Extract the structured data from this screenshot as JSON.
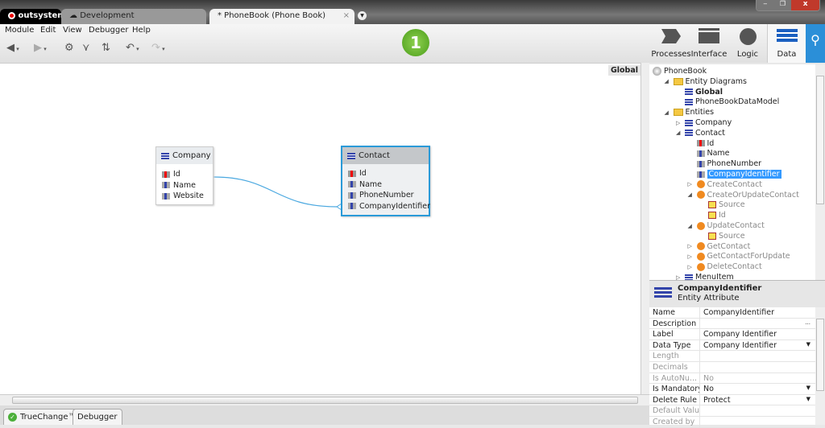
{
  "titlebar": {
    "logo": "outsystems",
    "tabs": [
      {
        "label": "Development"
      },
      {
        "label": "* PhoneBook (Phone Book)"
      }
    ],
    "close_tab": "×",
    "window_controls": [
      "minimize",
      "restore",
      "close"
    ]
  },
  "menu": [
    "Module",
    "Edit",
    "View",
    "Debugger",
    "Help"
  ],
  "step_badge": "1",
  "layers": [
    {
      "label": "Processes",
      "icon": "process-icon"
    },
    {
      "label": "Interface",
      "icon": "interface-icon"
    },
    {
      "label": "Logic",
      "icon": "logic-icon"
    },
    {
      "label": "Data",
      "icon": "data-icon",
      "active": true
    }
  ],
  "canvas": {
    "diagram_label": "Global",
    "entities": [
      {
        "name": "Company",
        "attributes": [
          "Id",
          "Name",
          "Website"
        ]
      },
      {
        "name": "Contact",
        "attributes": [
          "Id",
          "Name",
          "PhoneNumber",
          "CompanyIdentifier"
        ],
        "selected": true
      }
    ]
  },
  "tree": [
    {
      "label": "PhoneBook",
      "level": 0,
      "icon": "globe"
    },
    {
      "label": "Entity Diagrams",
      "level": 1,
      "icon": "folder",
      "open": true
    },
    {
      "label": "Global",
      "level": 2,
      "icon": "diagram",
      "bold": true
    },
    {
      "label": "PhoneBookDataModel",
      "level": 2,
      "icon": "diagram"
    },
    {
      "label": "Entities",
      "level": 1,
      "icon": "folder",
      "open": true
    },
    {
      "label": "Company",
      "level": 2,
      "icon": "entity",
      "closed": true
    },
    {
      "label": "Contact",
      "level": 2,
      "icon": "entity",
      "open": true
    },
    {
      "label": "Id",
      "level": 3,
      "icon": "key"
    },
    {
      "label": "Name",
      "level": 3,
      "icon": "attr"
    },
    {
      "label": "PhoneNumber",
      "level": 3,
      "icon": "attr"
    },
    {
      "label": "CompanyIdentifier",
      "level": 3,
      "icon": "attr",
      "selected": true
    },
    {
      "label": "CreateContact",
      "level": 3,
      "icon": "action",
      "closed": true,
      "grey": true
    },
    {
      "label": "CreateOrUpdateContact",
      "level": 3,
      "icon": "action",
      "open": true,
      "grey": true
    },
    {
      "label": "Source",
      "level": 4,
      "icon": "param",
      "grey": true
    },
    {
      "label": "Id",
      "level": 4,
      "icon": "param",
      "grey": true
    },
    {
      "label": "UpdateContact",
      "level": 3,
      "icon": "action",
      "open": true,
      "grey": true
    },
    {
      "label": "Source",
      "level": 4,
      "icon": "param",
      "grey": true
    },
    {
      "label": "GetContact",
      "level": 3,
      "icon": "action",
      "closed": true,
      "grey": true
    },
    {
      "label": "GetContactForUpdate",
      "level": 3,
      "icon": "action",
      "closed": true,
      "grey": true
    },
    {
      "label": "DeleteContact",
      "level": 3,
      "icon": "action",
      "closed": true,
      "grey": true
    },
    {
      "label": "MenuItem",
      "level": 2,
      "icon": "entity",
      "closed": true
    }
  ],
  "properties": {
    "title": "CompanyIdentifier",
    "subtitle": "Entity Attribute",
    "rows": [
      {
        "key": "Name",
        "value": "CompanyIdentifier"
      },
      {
        "key": "Description",
        "value": "",
        "ellipsis": "..."
      },
      {
        "key": "Label",
        "value": "Company Identifier"
      },
      {
        "key": "Data Type",
        "value": "Company Identifier",
        "dropdown": true
      },
      {
        "key": "Length",
        "value": "",
        "disabled": true
      },
      {
        "key": "Decimals",
        "value": "",
        "disabled": true
      },
      {
        "key": "Is AutoNu...",
        "value": "No",
        "disabled": true
      },
      {
        "key": "Is Mandatory",
        "value": "No",
        "dropdown": true
      },
      {
        "key": "Delete Rule",
        "value": "Protect",
        "dropdown": true
      },
      {
        "key": "Default Value",
        "value": "",
        "disabled": true
      },
      {
        "key": "Created by",
        "value": "",
        "disabled": true
      }
    ]
  },
  "bottom_tabs": [
    "TrueChange™",
    "Debugger"
  ]
}
